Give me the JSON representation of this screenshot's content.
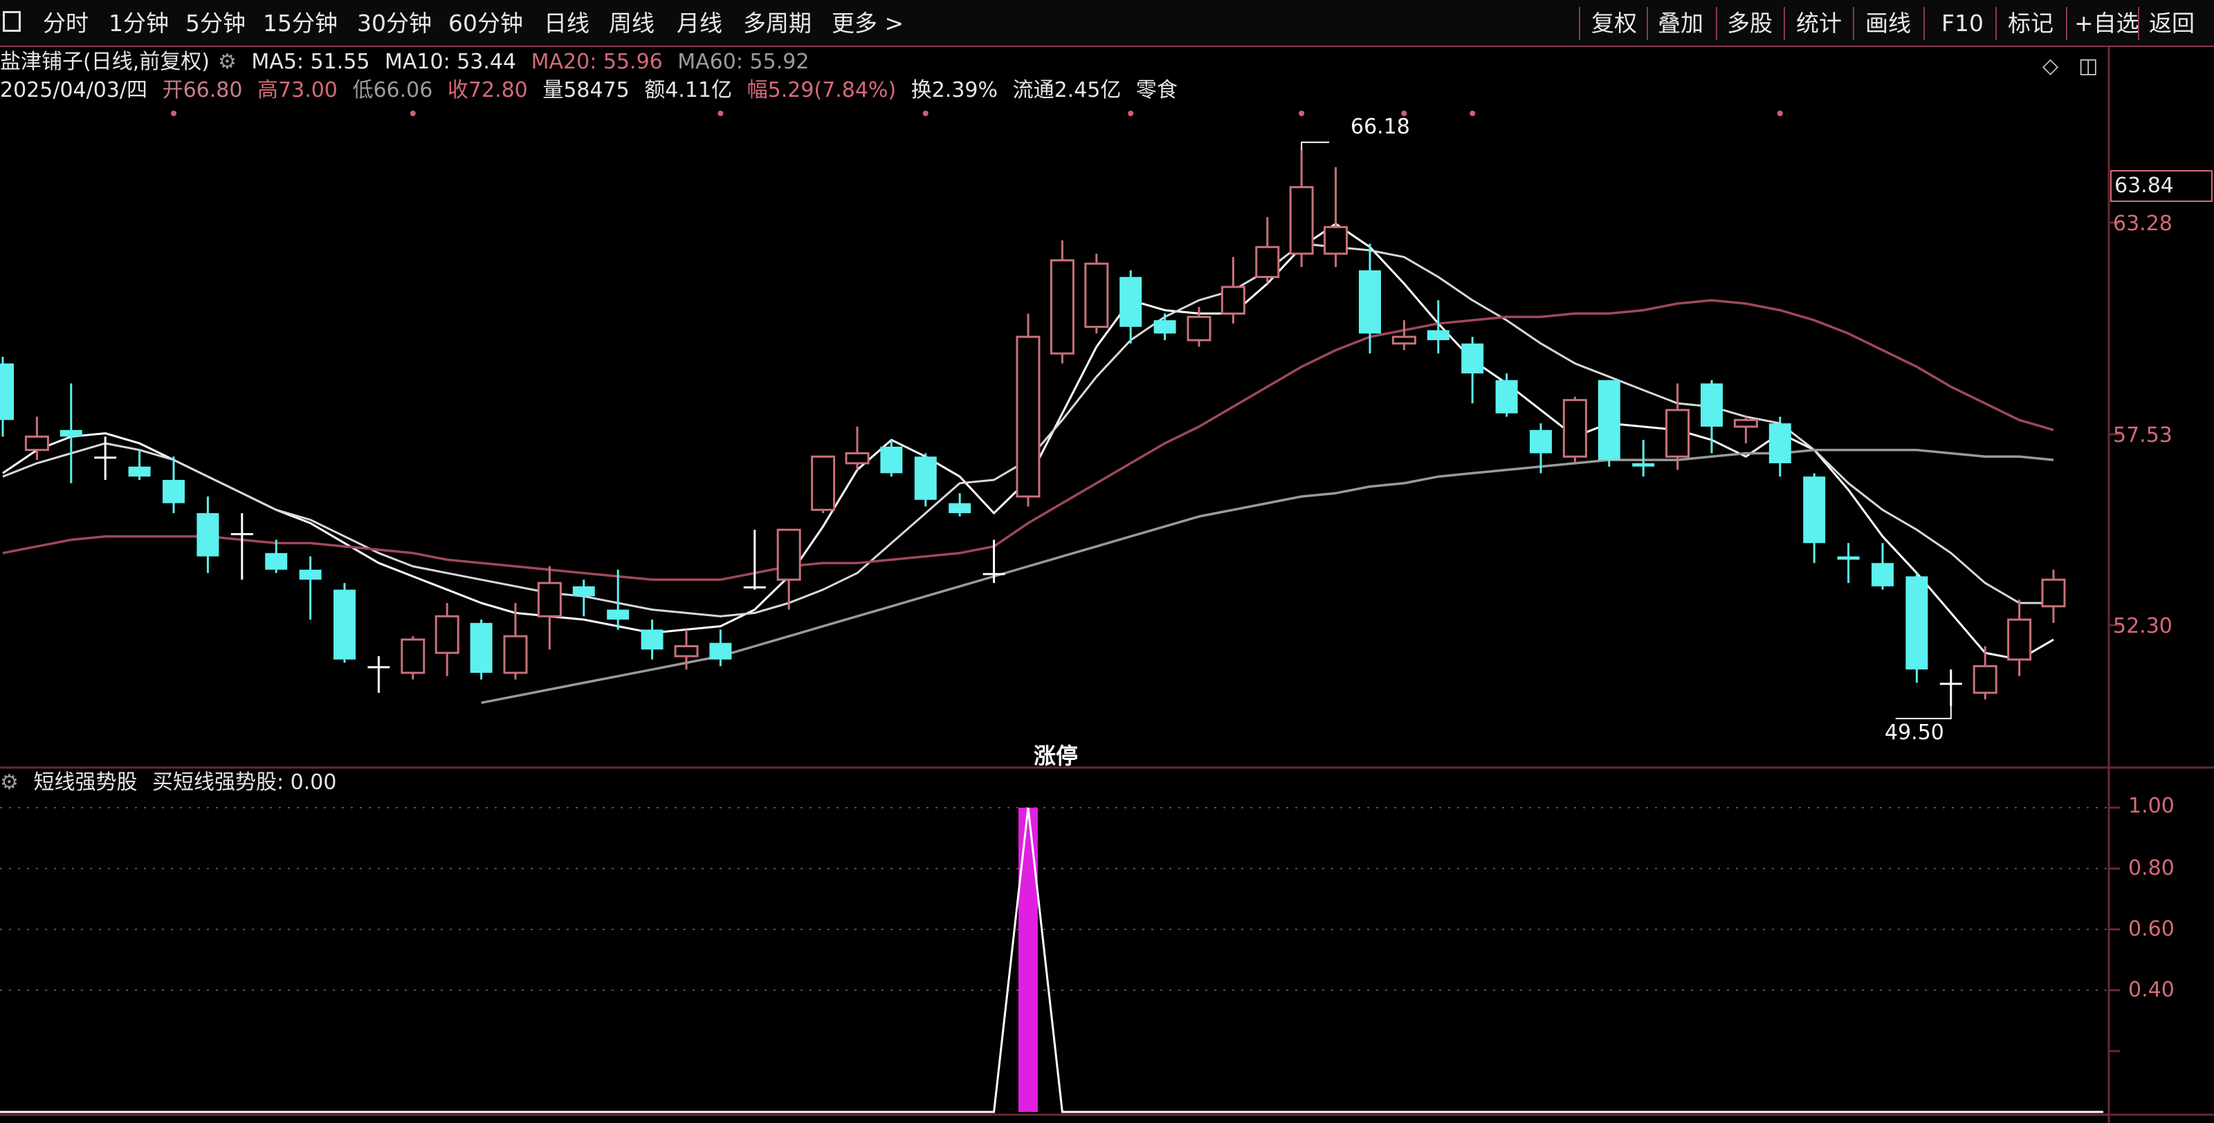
{
  "toolbar": {
    "left_items": [
      "分时",
      "1分钟",
      "5分钟",
      "15分钟",
      "30分钟",
      "60分钟",
      "日线",
      "周线",
      "月线",
      "多周期",
      "更多 >"
    ],
    "right_items": [
      "复权",
      "叠加",
      "多股",
      "统计",
      "画线",
      "F10",
      "标记",
      "+自选",
      "返回"
    ]
  },
  "header": {
    "stock_name": "盐津铺子(日线,前复权)",
    "ma5_label": "MA5: 51.55",
    "ma10_label": "MA10: 53.44",
    "ma20_label": "MA20: 55.96",
    "ma60_label": "MA60: 55.92",
    "date_label": "2025/04/03/四",
    "open_label": "开66.80",
    "high_label": "高73.00",
    "low_label": "低66.06",
    "close_label": "收72.80",
    "volume_label": "量58475",
    "amount_label": "额4.11亿",
    "change_label": "幅5.29(7.84%)",
    "turnover_label": "换2.39%",
    "float_label": "流通2.45亿",
    "industry_label": "零食"
  },
  "price_axis": {
    "labels": [
      "63.28",
      "57.53",
      "52.30"
    ],
    "current_price": "63.84"
  },
  "indicator": {
    "title": "短线强势股",
    "value_label": "买短线强势股: 0.00",
    "axis_labels": [
      "1.00",
      "0.80",
      "0.60",
      "0.40"
    ]
  },
  "annotations": {
    "high_mark": "66.18",
    "low_mark": "49.50",
    "limit_up_mark": "涨停"
  },
  "colors": {
    "up": "#c9707a",
    "down": "#5cf0ee",
    "ma5": "#ffffff",
    "ma10": "#d8d8d8",
    "ma20": "#a04858",
    "ma60": "#9a9a9a",
    "signal_bar": "#e020e0",
    "grid": "#6a2a36"
  },
  "chart_data": {
    "type": "candlestick",
    "ylim": [
      48.4,
      67.4
    ],
    "candles": [
      {
        "open": 59.8,
        "close": 58.1,
        "high": 60.0,
        "low": 57.6
      },
      {
        "open": 57.2,
        "close": 57.6,
        "high": 58.2,
        "low": 56.9
      },
      {
        "open": 57.8,
        "close": 57.6,
        "high": 59.2,
        "low": 56.2
      },
      {
        "open": 57.0,
        "close": 57.0,
        "high": 57.6,
        "low": 56.3
      },
      {
        "open": 56.7,
        "close": 56.4,
        "high": 57.2,
        "low": 56.3
      },
      {
        "open": 56.3,
        "close": 55.6,
        "high": 57.0,
        "low": 55.3
      },
      {
        "open": 55.3,
        "close": 54.0,
        "high": 55.8,
        "low": 53.5
      },
      {
        "open": 54.7,
        "close": 54.7,
        "high": 55.3,
        "low": 53.3
      },
      {
        "open": 54.1,
        "close": 53.6,
        "high": 54.5,
        "low": 53.5
      },
      {
        "open": 53.6,
        "close": 53.3,
        "high": 54.0,
        "low": 52.1
      },
      {
        "open": 53.0,
        "close": 50.9,
        "high": 53.2,
        "low": 50.8
      },
      {
        "open": 50.7,
        "close": 50.7,
        "high": 51.0,
        "low": 49.9
      },
      {
        "open": 50.5,
        "close": 51.5,
        "high": 51.6,
        "low": 50.3
      },
      {
        "open": 51.1,
        "close": 52.2,
        "high": 52.6,
        "low": 50.4
      },
      {
        "open": 52.0,
        "close": 50.5,
        "high": 52.1,
        "low": 50.3
      },
      {
        "open": 50.5,
        "close": 51.6,
        "high": 52.6,
        "low": 50.3
      },
      {
        "open": 52.2,
        "close": 53.2,
        "high": 53.7,
        "low": 51.2
      },
      {
        "open": 53.1,
        "close": 52.8,
        "high": 53.3,
        "low": 52.2
      },
      {
        "open": 52.4,
        "close": 52.1,
        "high": 53.6,
        "low": 51.8
      },
      {
        "open": 51.8,
        "close": 51.2,
        "high": 52.1,
        "low": 50.9
      },
      {
        "open": 51.0,
        "close": 51.3,
        "high": 51.8,
        "low": 50.6
      },
      {
        "open": 51.4,
        "close": 50.9,
        "high": 51.8,
        "low": 50.7
      },
      {
        "open": 53.1,
        "close": 53.1,
        "high": 54.8,
        "low": 53.0
      },
      {
        "open": 53.3,
        "close": 54.8,
        "high": 54.8,
        "low": 52.4
      },
      {
        "open": 55.4,
        "close": 57.0,
        "high": 57.0,
        "low": 55.3
      },
      {
        "open": 56.8,
        "close": 57.1,
        "high": 57.9,
        "low": 56.6
      },
      {
        "open": 57.3,
        "close": 56.5,
        "high": 57.5,
        "low": 56.4
      },
      {
        "open": 57.0,
        "close": 55.7,
        "high": 57.1,
        "low": 55.5
      },
      {
        "open": 55.6,
        "close": 55.3,
        "high": 55.9,
        "low": 55.2
      },
      {
        "open": 53.5,
        "close": 53.5,
        "high": 54.5,
        "low": 53.2
      },
      {
        "open": 55.8,
        "close": 60.6,
        "high": 61.3,
        "low": 55.5
      },
      {
        "open": 60.1,
        "close": 62.9,
        "high": 63.5,
        "low": 59.8
      },
      {
        "open": 60.9,
        "close": 62.8,
        "high": 63.1,
        "low": 60.7
      },
      {
        "open": 62.4,
        "close": 60.9,
        "high": 62.6,
        "low": 60.4
      },
      {
        "open": 61.1,
        "close": 60.7,
        "high": 61.3,
        "low": 60.5
      },
      {
        "open": 60.5,
        "close": 61.2,
        "high": 61.5,
        "low": 60.3
      },
      {
        "open": 61.3,
        "close": 62.1,
        "high": 63.0,
        "low": 61.0
      },
      {
        "open": 62.4,
        "close": 63.3,
        "high": 64.2,
        "low": 62.2
      },
      {
        "open": 63.1,
        "close": 65.1,
        "high": 66.2,
        "low": 62.7
      },
      {
        "open": 63.1,
        "close": 63.9,
        "high": 65.7,
        "low": 62.7
      },
      {
        "open": 62.6,
        "close": 60.7,
        "high": 63.4,
        "low": 60.1
      },
      {
        "open": 60.4,
        "close": 60.6,
        "high": 61.1,
        "low": 60.2
      },
      {
        "open": 60.8,
        "close": 60.5,
        "high": 61.7,
        "low": 60.1
      },
      {
        "open": 60.4,
        "close": 59.5,
        "high": 60.6,
        "low": 58.6
      },
      {
        "open": 59.3,
        "close": 58.3,
        "high": 59.5,
        "low": 58.2
      },
      {
        "open": 57.8,
        "close": 57.1,
        "high": 58.0,
        "low": 56.5
      },
      {
        "open": 57.0,
        "close": 58.7,
        "high": 58.8,
        "low": 56.8
      },
      {
        "open": 59.3,
        "close": 56.9,
        "high": 59.3,
        "low": 56.7
      },
      {
        "open": 56.8,
        "close": 56.7,
        "high": 57.5,
        "low": 56.4
      },
      {
        "open": 57.0,
        "close": 58.4,
        "high": 59.2,
        "low": 56.6
      },
      {
        "open": 59.2,
        "close": 57.9,
        "high": 59.3,
        "low": 57.1
      },
      {
        "open": 57.9,
        "close": 58.1,
        "high": 58.2,
        "low": 57.4
      },
      {
        "open": 58.0,
        "close": 56.8,
        "high": 58.2,
        "low": 56.4
      },
      {
        "open": 56.4,
        "close": 54.4,
        "high": 56.5,
        "low": 53.8
      },
      {
        "open": 54.0,
        "close": 53.9,
        "high": 54.4,
        "low": 53.2
      },
      {
        "open": 53.8,
        "close": 53.1,
        "high": 54.4,
        "low": 53.0
      },
      {
        "open": 53.4,
        "close": 50.6,
        "high": 53.5,
        "low": 50.2
      },
      {
        "open": 50.2,
        "close": 50.2,
        "high": 50.6,
        "low": 49.5
      },
      {
        "open": 49.9,
        "close": 50.7,
        "high": 51.3,
        "low": 49.7
      },
      {
        "open": 50.9,
        "close": 52.1,
        "high": 52.7,
        "low": 50.4
      },
      {
        "open": 52.5,
        "close": 53.3,
        "high": 53.6,
        "low": 52.0
      }
    ],
    "ma_series": [
      {
        "name": "MA5",
        "values": [
          56.5,
          57.2,
          57.6,
          57.7,
          57.4,
          56.9,
          56.4,
          55.9,
          55.4,
          55.0,
          54.4,
          53.8,
          53.4,
          53.0,
          52.6,
          52.3,
          52.2,
          52.1,
          51.9,
          51.7,
          51.8,
          51.9,
          52.4,
          53.4,
          54.9,
          56.6,
          57.5,
          57.0,
          56.4,
          55.3,
          56.3,
          58.3,
          60.3,
          61.7,
          61.4,
          61.3,
          61.3,
          62.2,
          63.3,
          64.0,
          63.3,
          62.2,
          61.0,
          59.9,
          59.2,
          58.4,
          57.6,
          58.0,
          57.9,
          57.8,
          57.5,
          57.0,
          57.7,
          57.2,
          56.0,
          54.6,
          53.5,
          52.3,
          51.1,
          50.9,
          51.5
        ]
      },
      {
        "name": "MA10",
        "values": [
          56.4,
          56.8,
          57.1,
          57.4,
          57.2,
          56.9,
          56.4,
          55.9,
          55.4,
          55.1,
          54.6,
          54.1,
          53.7,
          53.5,
          53.3,
          53.1,
          52.9,
          52.8,
          52.6,
          52.4,
          52.3,
          52.2,
          52.3,
          52.6,
          53.0,
          53.5,
          54.4,
          55.3,
          56.2,
          56.3,
          56.9,
          58.1,
          59.4,
          60.5,
          61.2,
          61.7,
          62.0,
          62.6,
          63.4,
          63.3,
          63.2,
          63.0,
          62.4,
          61.7,
          61.1,
          60.4,
          59.8,
          59.4,
          59.0,
          58.6,
          58.5,
          58.2,
          58.0,
          57.2,
          56.2,
          55.4,
          54.8,
          54.1,
          53.2,
          52.6,
          52.6
        ]
      },
      {
        "name": "MA20",
        "values": [
          54.1,
          54.3,
          54.5,
          54.6,
          54.6,
          54.6,
          54.6,
          54.5,
          54.4,
          54.4,
          54.3,
          54.2,
          54.1,
          53.9,
          53.8,
          53.7,
          53.6,
          53.5,
          53.4,
          53.3,
          53.3,
          53.3,
          53.5,
          53.7,
          53.8,
          53.8,
          53.9,
          54.0,
          54.1,
          54.3,
          55.0,
          55.6,
          56.2,
          56.8,
          57.4,
          57.9,
          58.5,
          59.1,
          59.7,
          60.2,
          60.6,
          60.8,
          61.0,
          61.1,
          61.2,
          61.2,
          61.3,
          61.3,
          61.4,
          61.6,
          61.7,
          61.6,
          61.4,
          61.1,
          60.7,
          60.2,
          59.7,
          59.1,
          58.6,
          58.1,
          57.8
        ]
      },
      {
        "name": "MA60",
        "values": [
          null,
          null,
          null,
          null,
          null,
          null,
          null,
          null,
          null,
          null,
          null,
          null,
          null,
          null,
          49.6,
          49.8,
          50.0,
          50.2,
          50.4,
          50.6,
          50.8,
          51.0,
          51.3,
          51.6,
          51.9,
          52.2,
          52.5,
          52.8,
          53.1,
          53.4,
          53.7,
          54.0,
          54.3,
          54.6,
          54.9,
          55.2,
          55.4,
          55.6,
          55.8,
          55.9,
          56.1,
          56.2,
          56.4,
          56.5,
          56.6,
          56.7,
          56.8,
          56.9,
          56.9,
          56.9,
          57.0,
          57.1,
          57.1,
          57.2,
          57.2,
          57.2,
          57.2,
          57.1,
          57.0,
          57.0,
          56.9
        ]
      }
    ],
    "indicator_series": {
      "name": "买短线强势股",
      "ylim": [
        0,
        1.05
      ],
      "signals": [
        {
          "index": 30,
          "value": 1.0
        }
      ],
      "line_values": [
        {
          "index": 29,
          "value": 0
        },
        {
          "index": 30,
          "value": 1.0
        },
        {
          "index": 31,
          "value": 0
        }
      ]
    }
  }
}
